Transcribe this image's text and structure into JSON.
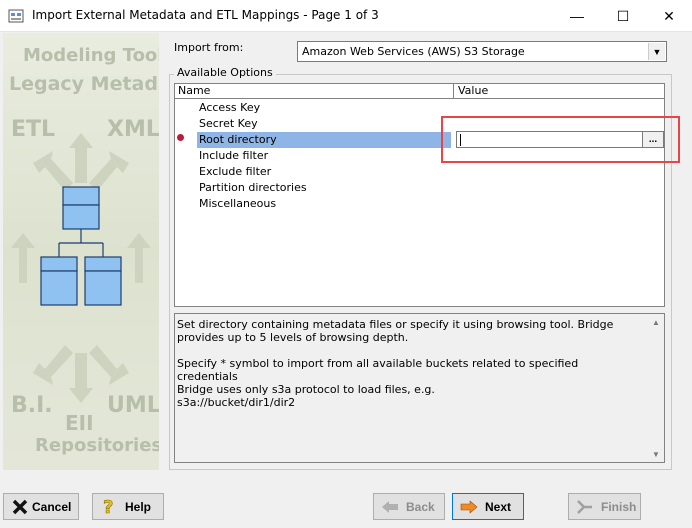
{
  "window": {
    "title": "Import External Metadata and ETL Mappings - Page 1 of 3",
    "minimize_glyph": "—",
    "maximize_glyph": "☐",
    "close_glyph": "✕"
  },
  "banner": {
    "line1": "Modeling Tools",
    "line2": "Legacy Metadata",
    "etl": "ETL",
    "xml": "XML",
    "bi": "B.I.",
    "uml": "UML",
    "eii": "EII",
    "repositories": "Repositories"
  },
  "import_from": {
    "label": "Import from:",
    "selected": "Amazon Web Services (AWS) S3 Storage"
  },
  "options": {
    "legend": "Available Options",
    "col_name": "Name",
    "col_value": "Value",
    "rows": [
      {
        "name": "Access Key"
      },
      {
        "name": "Secret Key"
      },
      {
        "name": "Root directory"
      },
      {
        "name": "Include filter"
      },
      {
        "name": "Exclude filter"
      },
      {
        "name": "Partition directories"
      },
      {
        "name": "Miscellaneous"
      }
    ],
    "selected_index": 2,
    "browse_label": "..."
  },
  "description": {
    "p1": "Set directory containing metadata files or specify it using browsing tool. Bridge provides up to 5 levels of browsing depth.",
    "p2": "Specify * symbol to import from all available buckets related to specified credentials",
    "p3a": "Bridge uses only s3a protocol to load files, e.g.",
    "p3b": "s3a://bucket/dir1/dir2"
  },
  "buttons": {
    "cancel": "Cancel",
    "help": "Help",
    "back": "Back",
    "next": "Next",
    "finish": "Finish"
  },
  "colors": {
    "selection": "#8fb4e6",
    "highlight_box": "#e8454a",
    "banner_text": "#b7beaa"
  }
}
